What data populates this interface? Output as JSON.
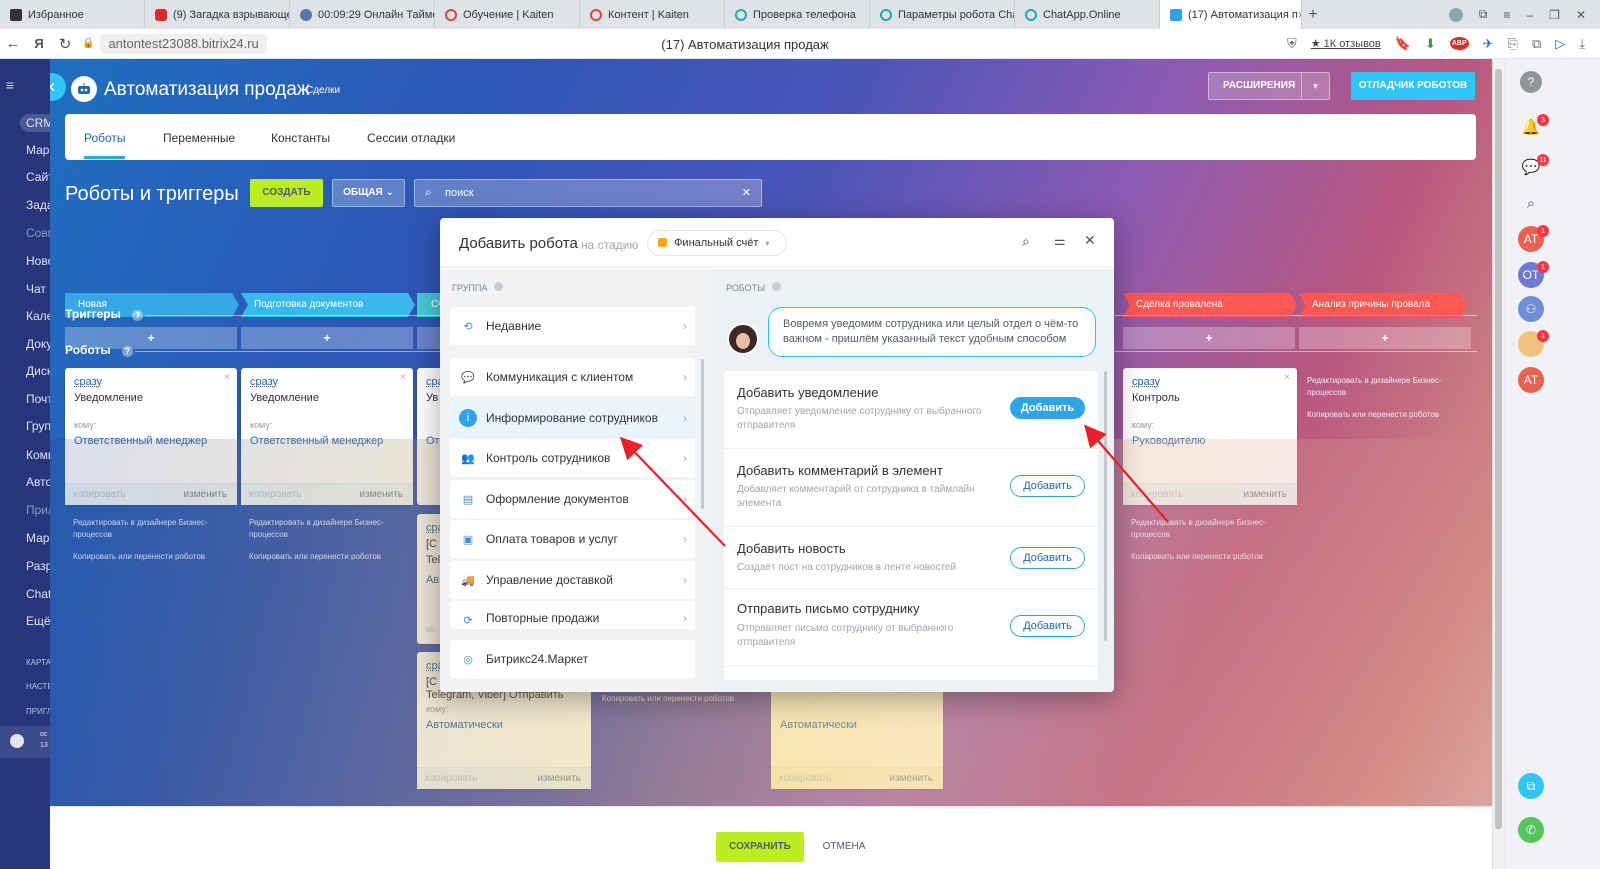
{
  "browser": {
    "tabs": [
      {
        "label": "Избранное",
        "color": "#222"
      },
      {
        "label": "(9) Загадка взрывающе",
        "color": "#e02a2a"
      },
      {
        "label": "00:09:29 Онлайн Таймер",
        "color": "#5577aa"
      },
      {
        "label": "Обучение | Kaiten",
        "color": "#e0443b"
      },
      {
        "label": "Контент | Kaiten",
        "color": "#e0443b"
      },
      {
        "label": "Проверка телефона",
        "color": "#27a7a7"
      },
      {
        "label": "Параметры робота Cha",
        "color": "#27a7a7"
      },
      {
        "label": "ChatApp.Online",
        "color": "#27a7a7"
      },
      {
        "label": "(17) Автоматизация п",
        "color": "#2fa5e8"
      }
    ],
    "url": "antontest23088.bitrix24.ru",
    "page_title": "(17) Автоматизация продаж",
    "reviews": "1К отзывов"
  },
  "left_sidebar": {
    "items": [
      "CRM",
      "Мар",
      "Сайт",
      "Зада",
      "Совм",
      "Ново",
      "Чат и",
      "Кале",
      "Доку",
      "Диск",
      "Почт",
      "Груп",
      "Комп",
      "Авто",
      "Прил",
      "Мар",
      "Разр",
      "Chat",
      "Ещё"
    ],
    "small": [
      "КАРТА",
      "НАСТР",
      "ПРИГЛ"
    ],
    "footer_top": "ос",
    "footer_bottom": "13"
  },
  "header": {
    "title": "Автоматизация продаж",
    "subtitle": "Сделки",
    "ext_label": "РАСШИРЕНИЯ",
    "debugger_label": "ОТЛАДЧИК РОБОТОВ"
  },
  "tabs": [
    "Роботы",
    "Переменные",
    "Константы",
    "Сессии отладки"
  ],
  "section": {
    "title": "Роботы и триггеры",
    "create": "СОЗДАТЬ",
    "general": "ОБЩАЯ",
    "search": "поиск",
    "triggers": "Триггеры",
    "robots": "Роботы"
  },
  "stages": [
    {
      "label": "Новая",
      "color": "#36a8e8"
    },
    {
      "label": "Подготовка документов",
      "color": "#39b8ee"
    },
    {
      "label": "Сч",
      "color": "#48c8d8"
    },
    {
      "label": "Сделка провалена",
      "color": "#ff5752"
    },
    {
      "label": "Анализ причины провала",
      "color": "#ff5752"
    }
  ],
  "plus": "+",
  "cards": {
    "when": "сразу",
    "notify": "Уведомление",
    "to": "кому:",
    "resp": "Ответственный менеджер",
    "control": "Контроль",
    "head": "Руководителю",
    "copy": "копировать",
    "edit": "изменить",
    "auto": "Автоматически",
    "partial_short": "Ув",
    "partial_resp": "От",
    "partial_c": "[C",
    "partial_tel": "Tel",
    "partial_av": "Ав",
    "partial_ko": "ко",
    "telegram": "Telegram, Viber] Отправить",
    "close": "×"
  },
  "under_links": {
    "bp": "Редактировать в дизайнере Бизнес-процессов",
    "copy_move": "Копировать или перенести роботов"
  },
  "popup": {
    "title": "Добавить робота",
    "on_stage": "на стадию",
    "stage": "Финальный счёт",
    "group_hdr": "ГРУППА",
    "robots_hdr": "РОБОТЫ",
    "groups": [
      {
        "label": "Недавние",
        "icon": "history-icon"
      },
      {
        "label": "Коммуникация с клиентом",
        "icon": "chat-icon"
      },
      {
        "label": "Информирование сотрудников",
        "icon": "info-icon"
      },
      {
        "label": "Контроль сотрудников",
        "icon": "users-icon"
      },
      {
        "label": "Оформление документов",
        "icon": "document-icon"
      },
      {
        "label": "Оплата товаров и услуг",
        "icon": "wallet-icon"
      },
      {
        "label": "Управление доставкой",
        "icon": "truck-icon"
      },
      {
        "label": "Повторные продажи",
        "icon": "repeat-icon"
      },
      {
        "label": "Битрикс24.Маркет",
        "icon": "market-icon"
      }
    ],
    "hint": "Вовремя уведомим сотрудника или целый отдел о чём-то важном - пришлём указанный текст удобным способом",
    "robots": [
      {
        "title": "Добавить уведомление",
        "desc": "Отправляет уведомление сотруднику от выбранного отправителя"
      },
      {
        "title": "Добавить комментарий в элемент",
        "desc": "Добавляет комментарий от сотрудника в таймлайн элемента"
      },
      {
        "title": "Добавить новость",
        "desc": "Создаёт пост на сотрудников в ленте новостей"
      },
      {
        "title": "Отправить письмо сотруднику",
        "desc": "Отправляет письмо сотруднику от выбранного отправителя"
      }
    ],
    "add": "Добавить"
  },
  "footer": {
    "save": "СОХРАНИТЬ",
    "cancel": "ОТМЕНА"
  },
  "right_bar": {
    "badges": [
      "3",
      "11",
      "1",
      "1",
      "1"
    ],
    "avatars": [
      "AT",
      "OT",
      "AT"
    ]
  },
  "colors": {
    "accent": "#2fa5e8",
    "lime": "#bbed21",
    "danger": "#ff5752"
  }
}
